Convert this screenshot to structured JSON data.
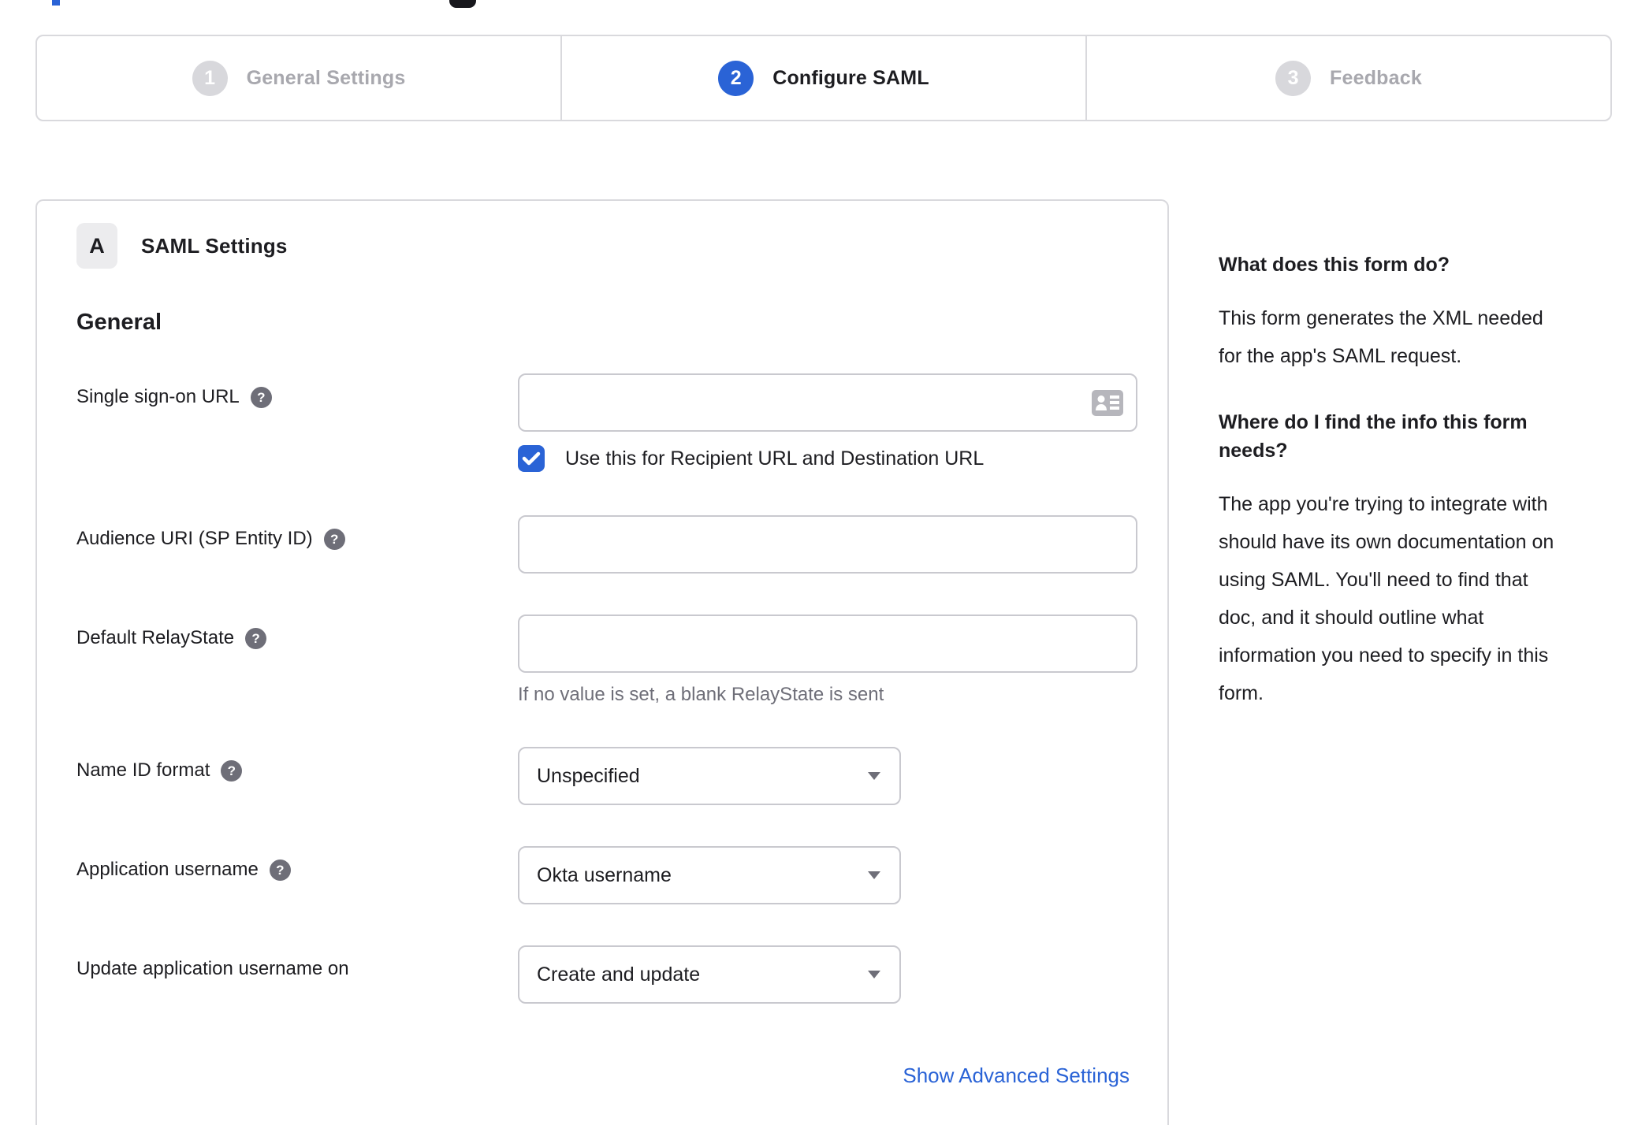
{
  "stepper": {
    "steps": [
      {
        "number": "1",
        "label": "General Settings",
        "active": false
      },
      {
        "number": "2",
        "label": "Configure SAML",
        "active": true
      },
      {
        "number": "3",
        "label": "Feedback",
        "active": false
      }
    ]
  },
  "saml_panel": {
    "section_badge": "A",
    "title": "SAML Settings",
    "subsection_title": "General",
    "fields": {
      "sso_url": {
        "label": "Single sign-on URL",
        "value": "",
        "checkbox_checked": true,
        "checkbox_label": "Use this for Recipient URL and Destination URL"
      },
      "audience_uri": {
        "label": "Audience URI (SP Entity ID)",
        "value": ""
      },
      "default_relay_state": {
        "label": "Default RelayState",
        "value": "",
        "helper": "If no value is set, a blank RelayState is sent"
      },
      "name_id_format": {
        "label": "Name ID format",
        "value": "Unspecified"
      },
      "application_username": {
        "label": "Application username",
        "value": "Okta username"
      },
      "update_app_username_on": {
        "label": "Update application username on",
        "value": "Create and update"
      }
    },
    "advanced_link": "Show Advanced Settings",
    "help_icon_glyph": "?"
  },
  "help_sidebar": {
    "heading1": "What does this form do?",
    "paragraph1": "This form generates the XML needed\nfor the app's SAML request.",
    "heading2": "Where do I find the info this form\nneeds?",
    "paragraph2": "The app you're trying to integrate with\nshould have its own documentation on\nusing SAML. You'll need to find that\ndoc, and it should outline what\ninformation you need to specify in this\nform."
  },
  "colors": {
    "accent_blue": "#2a63d6",
    "inactive_gray": "#a8a8ae",
    "badge_gray": "#d8d8dc",
    "border_gray": "#d9d9dd",
    "text_dark": "#1d1d21",
    "muted_text": "#6e6e78",
    "icon_gray": "#b6b6bc"
  }
}
